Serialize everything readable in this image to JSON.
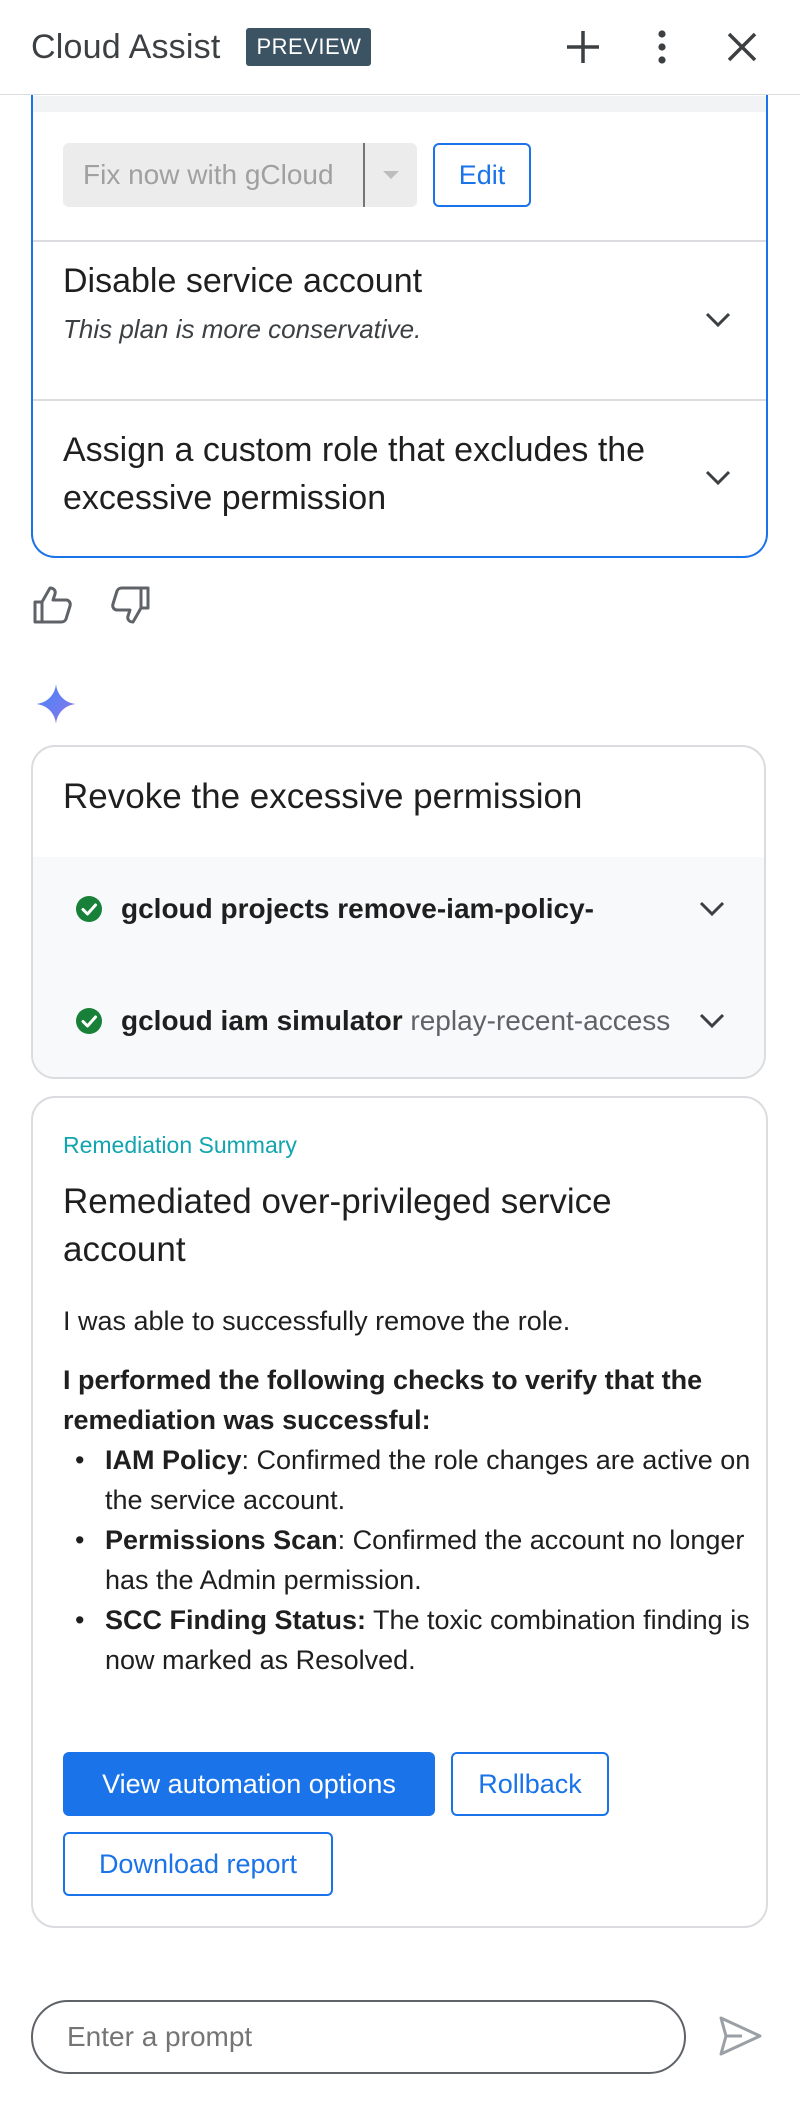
{
  "header": {
    "title": "Cloud Assist",
    "badge": "PREVIEW"
  },
  "plan_card": {
    "fix_button": "Fix now with gCloud",
    "edit_button": "Edit",
    "options": [
      {
        "title": "Disable service account",
        "subtitle": "This plan is more conservative."
      },
      {
        "title": "Assign a custom role that excludes the excessive permission"
      }
    ]
  },
  "revoke_card": {
    "title": "Revoke the excessive permission",
    "commands": [
      {
        "bold": "gcloud projects remove-iam-policy-",
        "rest": ""
      },
      {
        "bold": "gcloud iam simulator",
        "rest": " replay-recent-access"
      }
    ]
  },
  "summary": {
    "kicker": "Remediation Summary",
    "title": "Remediated over-privileged service account",
    "paragraph": "I was able to successfully remove the role.",
    "checks_heading": "I performed the following checks to verify that the remediation was successful:",
    "checks": [
      {
        "label": "IAM Policy",
        "text": ": Confirmed the role changes are active on the service account."
      },
      {
        "label": "Permissions Scan",
        "text": ": Confirmed the account no longer has the Admin permission."
      },
      {
        "label": "SCC Finding Status:",
        "text": " The toxic combination finding is now marked as Resolved."
      }
    ],
    "buttons": {
      "automation": "View automation options",
      "rollback": "Rollback",
      "download": "Download report"
    }
  },
  "prompt": {
    "placeholder": "Enter a prompt"
  },
  "colors": {
    "accent": "#1a73e8",
    "badge_bg": "#3c5363",
    "success": "#188038",
    "kicker": "#12a4af"
  },
  "icons": [
    "plus-icon",
    "more-vert-icon",
    "close-icon",
    "dropdown-caret-icon",
    "chevron-down-icon",
    "thumb-up-icon",
    "thumb-down-icon",
    "sparkle-icon",
    "check-circle-icon",
    "send-icon"
  ]
}
